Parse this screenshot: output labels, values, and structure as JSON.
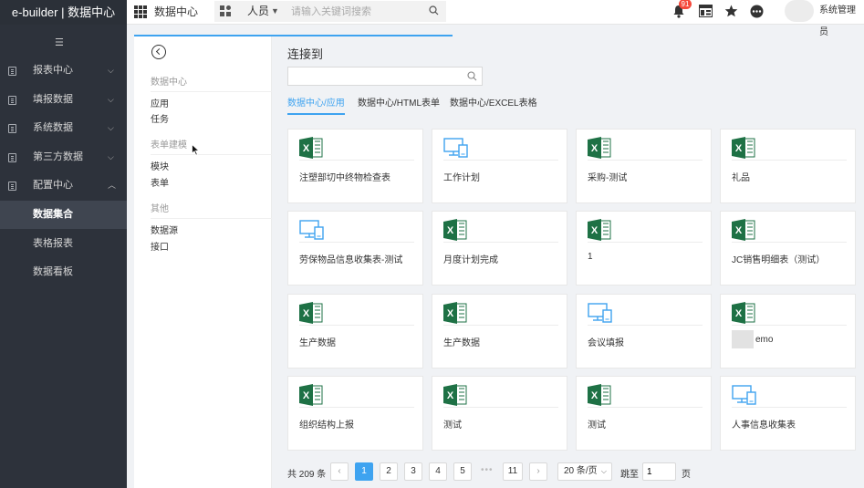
{
  "brand": "e-builder | 数据中心",
  "topbar": {
    "module_title": "数据中心",
    "search_scope": "人员",
    "search_placeholder": "请输入关键词搜索",
    "notification_count": "91",
    "username": "系统管理员"
  },
  "sidebar": {
    "items": [
      {
        "label": "报表中心",
        "chevron": "down"
      },
      {
        "label": "填报数据",
        "chevron": "down"
      },
      {
        "label": "系统数据",
        "chevron": "down"
      },
      {
        "label": "第三方数据",
        "chevron": "down"
      },
      {
        "label": "配置中心",
        "chevron": "up"
      }
    ],
    "sub_items": [
      {
        "label": "数据集合",
        "active": true
      },
      {
        "label": "表格报表",
        "active": false
      },
      {
        "label": "数据看板",
        "active": false
      }
    ]
  },
  "panel": {
    "groups": [
      {
        "title": "数据中心",
        "items": [
          "应用",
          "任务"
        ]
      },
      {
        "title": "表单建模",
        "items": [
          "模块",
          "表单"
        ]
      },
      {
        "title": "其他",
        "items": [
          "数据源",
          "接口"
        ]
      }
    ]
  },
  "main": {
    "title": "连接到",
    "search_value": "",
    "tabs": [
      {
        "label": "数据中心/应用",
        "active": true
      },
      {
        "label": "数据中心/HTML表单",
        "active": false
      },
      {
        "label": "数据中心/EXCEL表格",
        "active": false
      }
    ],
    "cards": [
      {
        "label": "注塑部切中终物检查表",
        "icon": "excel-icon"
      },
      {
        "label": "工作计划",
        "icon": "form-icon"
      },
      {
        "label": "采购-测试",
        "icon": "excel-icon"
      },
      {
        "label": "礼品",
        "icon": "excel-icon"
      },
      {
        "label": "劳保物品信息收集表-测试",
        "icon": "form-icon"
      },
      {
        "label": "月度计划完成",
        "icon": "excel-icon"
      },
      {
        "label": "1",
        "icon": "excel-icon"
      },
      {
        "label": "JC销售明细表（测试）",
        "icon": "excel-icon"
      },
      {
        "label": "生产数据",
        "icon": "excel-icon"
      },
      {
        "label": "生产数据",
        "icon": "excel-icon"
      },
      {
        "label": "会议填报",
        "icon": "form-icon"
      },
      {
        "label": "emo",
        "icon": "excel-icon"
      },
      {
        "label": "组织结构上报",
        "icon": "excel-icon"
      },
      {
        "label": "测试",
        "icon": "excel-icon"
      },
      {
        "label": "测试",
        "icon": "excel-icon"
      },
      {
        "label": "人事信息收集表",
        "icon": "form-icon"
      }
    ]
  },
  "pagination": {
    "total": "共 209 条",
    "pages": [
      "1",
      "2",
      "3",
      "4",
      "5"
    ],
    "ellipsis": "•••",
    "last_page": "11",
    "current_page": 1,
    "page_size": "20 条/页",
    "jump_label": "跳至",
    "jump_value": "1",
    "jump_suffix": "页"
  },
  "colors": {
    "accent": "#3ea3f0",
    "sidebar_bg": "#2d323b",
    "excel_green": "#1e7145",
    "badge_red": "#f5483b"
  }
}
